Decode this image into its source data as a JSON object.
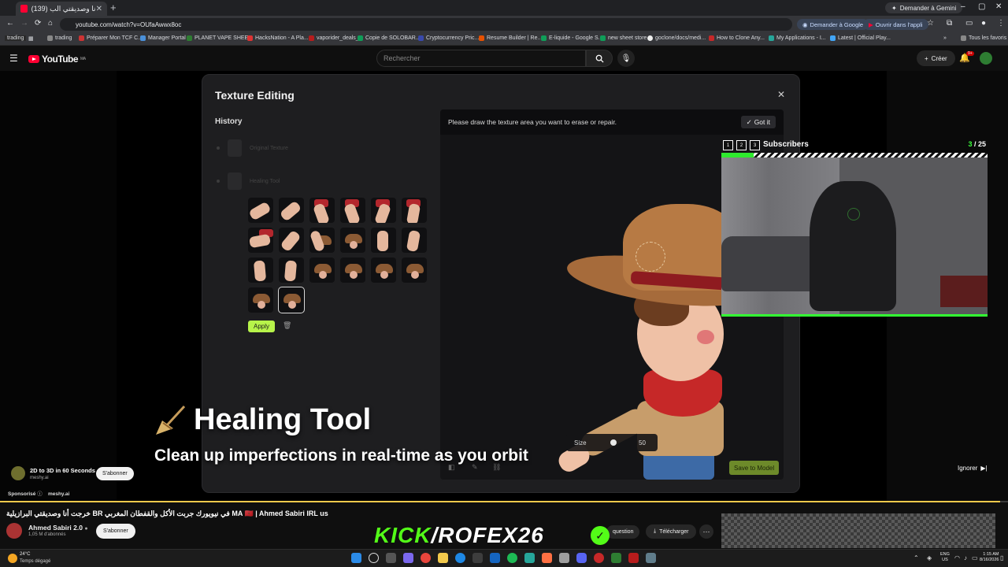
{
  "browser": {
    "tab_title": "(139) خرجت أنا وصديقتي الب",
    "tab_count_badge": "",
    "gemini_pill": "Demander à Gemini",
    "url": "youtube.com/watch?v=OUfaAwwx8oc",
    "ask_google": "Demander à Google",
    "open_app": "Ouvrir dans l'appli",
    "bookmarks": [
      "trading",
      "Préparer Mon TCF C...",
      "Manager Portal",
      "PLANET VAPE SHEE...",
      "HacksNation - A Pla...",
      "vaporider_deals_",
      "Copie de SOLOBAR...",
      "Cryptocurrency Pric...",
      "Resume Builder | Re...",
      "E-liquide - Google S...",
      "new sheet store",
      "goclone/docs/medi...",
      "How to Clone Any...",
      "My Applications - I...",
      "Latest | Official Play..."
    ],
    "all_favorites": "Tous les favoris"
  },
  "youtube": {
    "logo_text": "YouTube",
    "region": "MA",
    "search_placeholder": "Rechercher",
    "create_label": "Créer",
    "notif_badge": "9+"
  },
  "dialog": {
    "title": "Texture Editing",
    "history_title": "History",
    "history_items": [
      "Original Texture",
      "Healing Tool"
    ],
    "hint": "Please draw the texture area you want to erase or repair.",
    "got_it": "Got it",
    "apply": "Apply",
    "size_label": "Size",
    "size_value": "50",
    "save_to_model": "Save to Model"
  },
  "overlay": {
    "title": "Healing Tool",
    "subtitle": "Clean up imperfections in real-time as you orbit",
    "subs_boxes": [
      "1",
      "2",
      "3"
    ],
    "subs_label": "Subscribers",
    "subs_current": "3",
    "subs_sep": " / ",
    "subs_goal": "25",
    "subs_fraction": 0.12
  },
  "ad": {
    "title": "2D to 3D in 60 Seconds",
    "domain": "meshy.ai",
    "subscribe": "S'abonner",
    "sponsored": "Sponsorisé",
    "sponsor_domain": "meshy.ai",
    "skip": "Ignorer"
  },
  "video": {
    "title": "خرجت أنا وصديقتي البرازيلية BR في نيويورك جربت الأكل والقفطان المغربي MA 🇲🇦 | Ahmed Sabiri IRL us",
    "channel": "Ahmed Sabiri 2.0",
    "channel_subs": "1,05 M d'abonnés",
    "subscribe": "S'abonner",
    "kick_brand": "KICK",
    "kick_handle": "/ROFEX26",
    "question": "question",
    "download": "Télécharger"
  },
  "taskbar": {
    "temp": "24°C",
    "weather": "Temps dégagé",
    "lang_line1": "ENG",
    "lang_line2": "US",
    "time": "1:15 AM",
    "date": "8/16/2026"
  },
  "colors": {
    "accent_green": "#53fc18",
    "apply_green": "#b7f34a",
    "yt_red": "#ff0033"
  }
}
